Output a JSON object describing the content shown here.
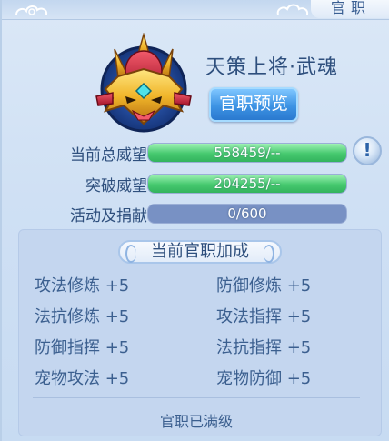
{
  "header": {
    "title": "官职"
  },
  "rank": {
    "name": "天策上将·武魂",
    "preview_label": "官职预览"
  },
  "stats": [
    {
      "label": "当前总威望",
      "value_text": "558459/--",
      "fill": 1.0
    },
    {
      "label": "突破威望",
      "value_text": "204255/--",
      "fill": 1.0
    },
    {
      "label": "活动及捐献",
      "value_text": "0/600",
      "fill": 0.0
    }
  ],
  "bonus": {
    "title": "当前官职加成",
    "items": [
      [
        "攻法修炼 +5",
        "防御修炼 +5"
      ],
      [
        "法抗修炼 +5",
        "攻法指挥 +5"
      ],
      [
        "防御指挥 +5",
        "法抗指挥 +5"
      ],
      [
        "宠物攻法 +5",
        "宠物防御 +5"
      ]
    ],
    "footer": "官职已满级"
  },
  "colors": {
    "panel_bg": "#cfe0f4",
    "text_primary": "#2e4f7d",
    "bar_fill": "#46c96f",
    "bar_empty": "#7891c4",
    "button_blue": "#3d93e4"
  },
  "icons": {
    "emblem": "golden-helmet-emblem-icon",
    "info": "exclamation-info-icon",
    "cloud": "cloud-ornament-icon"
  }
}
